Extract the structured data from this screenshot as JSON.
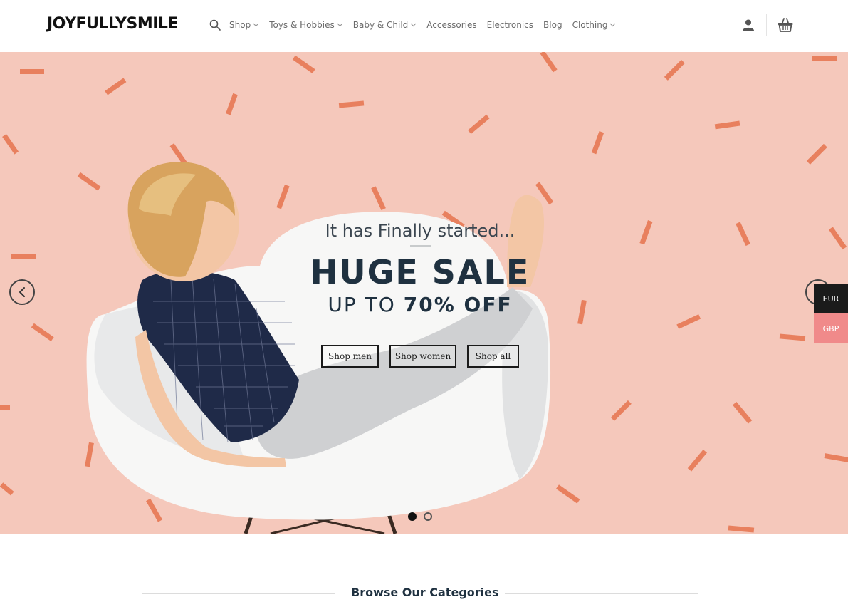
{
  "brand": {
    "logo_text": "JOYFULLYSMILE"
  },
  "nav": {
    "items": [
      {
        "label": "Shop",
        "has_dropdown": true
      },
      {
        "label": "Toys & Hobbies",
        "has_dropdown": true
      },
      {
        "label": "Baby & Child",
        "has_dropdown": true
      },
      {
        "label": "Accessories",
        "has_dropdown": false
      },
      {
        "label": "Electronics",
        "has_dropdown": false
      },
      {
        "label": "Blog",
        "has_dropdown": false
      },
      {
        "label": "Clothing",
        "has_dropdown": true
      }
    ],
    "icons": {
      "search": "search-icon",
      "account": "user-icon",
      "cart": "basket-icon"
    }
  },
  "hero": {
    "kicker": "It has Finally started...",
    "title": "HUGE SALE",
    "subtitle_prefix": "UP TO ",
    "subtitle_highlight": "70% OFF",
    "buttons": [
      "Shop men",
      "Shop women",
      "Shop all"
    ],
    "slides_total": 2,
    "active_slide": 1
  },
  "currency": {
    "options": [
      "EUR",
      "GBP"
    ],
    "selected": "EUR"
  },
  "categories": {
    "heading": "Browse Our Categories"
  },
  "colors": {
    "hero_background": "#f5c8bb",
    "confetti": "#e8805e",
    "heading_dark": "#1f3140",
    "currency_active": "#1b1b1b",
    "currency_inactive": "#f08a8a"
  }
}
